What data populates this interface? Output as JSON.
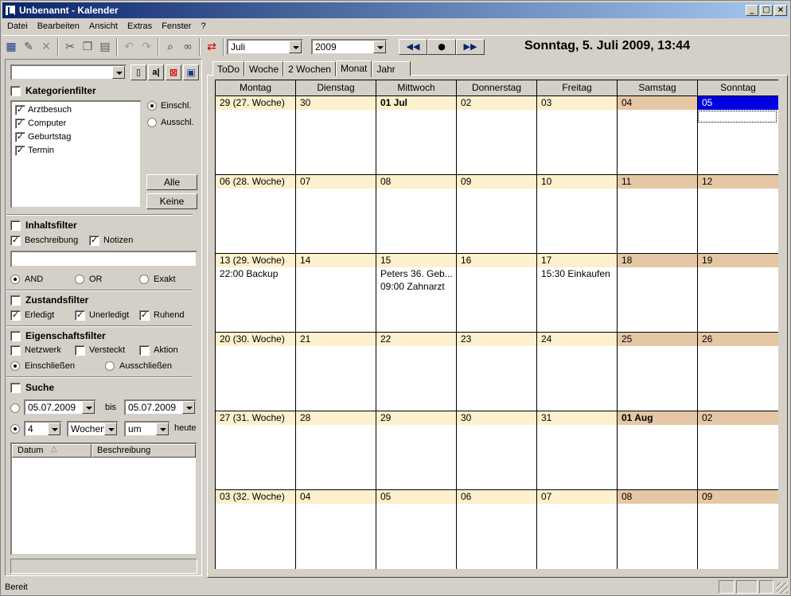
{
  "window": {
    "title": "Unbenannt - Kalender"
  },
  "menu": [
    "Datei",
    "Bearbeiten",
    "Ansicht",
    "Extras",
    "Fenster",
    "?"
  ],
  "toolbar": {
    "month": "Juli",
    "year": "2009",
    "current_datetime": "Sonntag, 5. Juli 2009, 13:44"
  },
  "filter": {
    "kategorie": {
      "title": "Kategorienfilter",
      "items": [
        {
          "label": "Arztbesuch",
          "checked": true
        },
        {
          "label": "Computer",
          "checked": true
        },
        {
          "label": "Geburtstag",
          "checked": true
        },
        {
          "label": "Termin",
          "checked": true
        }
      ],
      "einschl": "Einschl.",
      "ausschl": "Ausschl.",
      "alle": "Alle",
      "keine": "Keine"
    },
    "inhalt": {
      "title": "Inhaltsfilter",
      "beschreibung": "Beschreibung",
      "notizen": "Notizen",
      "and": "AND",
      "or": "OR",
      "exakt": "Exakt"
    },
    "zustand": {
      "title": "Zustandsfilter",
      "erledigt": "Erledigt",
      "unerledigt": "Unerledigt",
      "ruhend": "Ruhend"
    },
    "eigenschaft": {
      "title": "Eigenschaftsfilter",
      "netzwerk": "Netzwerk",
      "versteckt": "Versteckt",
      "aktion": "Aktion",
      "einschliessen": "Einschließen",
      "ausschliessen": "Ausschließen"
    },
    "suche": {
      "title": "Suche",
      "from": "05.07.2009",
      "bis": "bis",
      "to": "05.07.2009",
      "count": "4",
      "unit": "Wochen",
      "um": "um",
      "heute": "heute",
      "col_datum": "Datum",
      "col_beschreibung": "Beschreibung"
    }
  },
  "tabs": [
    "ToDo",
    "Woche",
    "2 Wochen",
    "Monat",
    "Jahr"
  ],
  "active_tab": "Monat",
  "calendar": {
    "days": [
      "Montag",
      "Dienstag",
      "Mittwoch",
      "Donnerstag",
      "Freitag",
      "Samstag",
      "Sonntag"
    ],
    "weeks": [
      {
        "cells": [
          {
            "label": "29 (27. Woche)",
            "events": []
          },
          {
            "label": "30",
            "events": []
          },
          {
            "label": "01 Jul",
            "bold": true,
            "events": []
          },
          {
            "label": "02",
            "events": []
          },
          {
            "label": "03",
            "events": []
          },
          {
            "label": "04",
            "events": []
          },
          {
            "label": "05",
            "today": true,
            "events": []
          }
        ]
      },
      {
        "cells": [
          {
            "label": "06 (28. Woche)",
            "events": []
          },
          {
            "label": "07",
            "events": []
          },
          {
            "label": "08",
            "events": []
          },
          {
            "label": "09",
            "events": []
          },
          {
            "label": "10",
            "events": []
          },
          {
            "label": "11",
            "events": []
          },
          {
            "label": "12",
            "events": []
          }
        ]
      },
      {
        "cells": [
          {
            "label": "13 (29. Woche)",
            "events": [
              "22:00 Backup"
            ]
          },
          {
            "label": "14",
            "events": []
          },
          {
            "label": "15",
            "events": [
              "Peters 36. Geb...",
              "09:00 Zahnarzt"
            ]
          },
          {
            "label": "16",
            "events": []
          },
          {
            "label": "17",
            "events": [
              "15:30 Einkaufen"
            ]
          },
          {
            "label": "18",
            "events": []
          },
          {
            "label": "19",
            "events": []
          }
        ]
      },
      {
        "cells": [
          {
            "label": "20 (30. Woche)",
            "events": []
          },
          {
            "label": "21",
            "events": []
          },
          {
            "label": "22",
            "events": []
          },
          {
            "label": "23",
            "events": []
          },
          {
            "label": "24",
            "events": []
          },
          {
            "label": "25",
            "events": []
          },
          {
            "label": "26",
            "events": []
          }
        ]
      },
      {
        "cells": [
          {
            "label": "27 (31. Woche)",
            "events": []
          },
          {
            "label": "28",
            "events": []
          },
          {
            "label": "29",
            "events": []
          },
          {
            "label": "30",
            "events": []
          },
          {
            "label": "31",
            "events": []
          },
          {
            "label": "01 Aug",
            "bold": true,
            "events": []
          },
          {
            "label": "02",
            "events": []
          }
        ]
      },
      {
        "cells": [
          {
            "label": "03 (32. Woche)",
            "events": []
          },
          {
            "label": "04",
            "events": []
          },
          {
            "label": "05",
            "events": []
          },
          {
            "label": "06",
            "events": []
          },
          {
            "label": "07",
            "events": []
          },
          {
            "label": "08",
            "events": []
          },
          {
            "label": "09",
            "events": []
          }
        ]
      }
    ]
  },
  "status": {
    "text": "Bereit"
  },
  "colors": {
    "weekday_label": "#fdf0cd",
    "weekend_label": "#e6c7a5",
    "today": "#0000e0"
  }
}
